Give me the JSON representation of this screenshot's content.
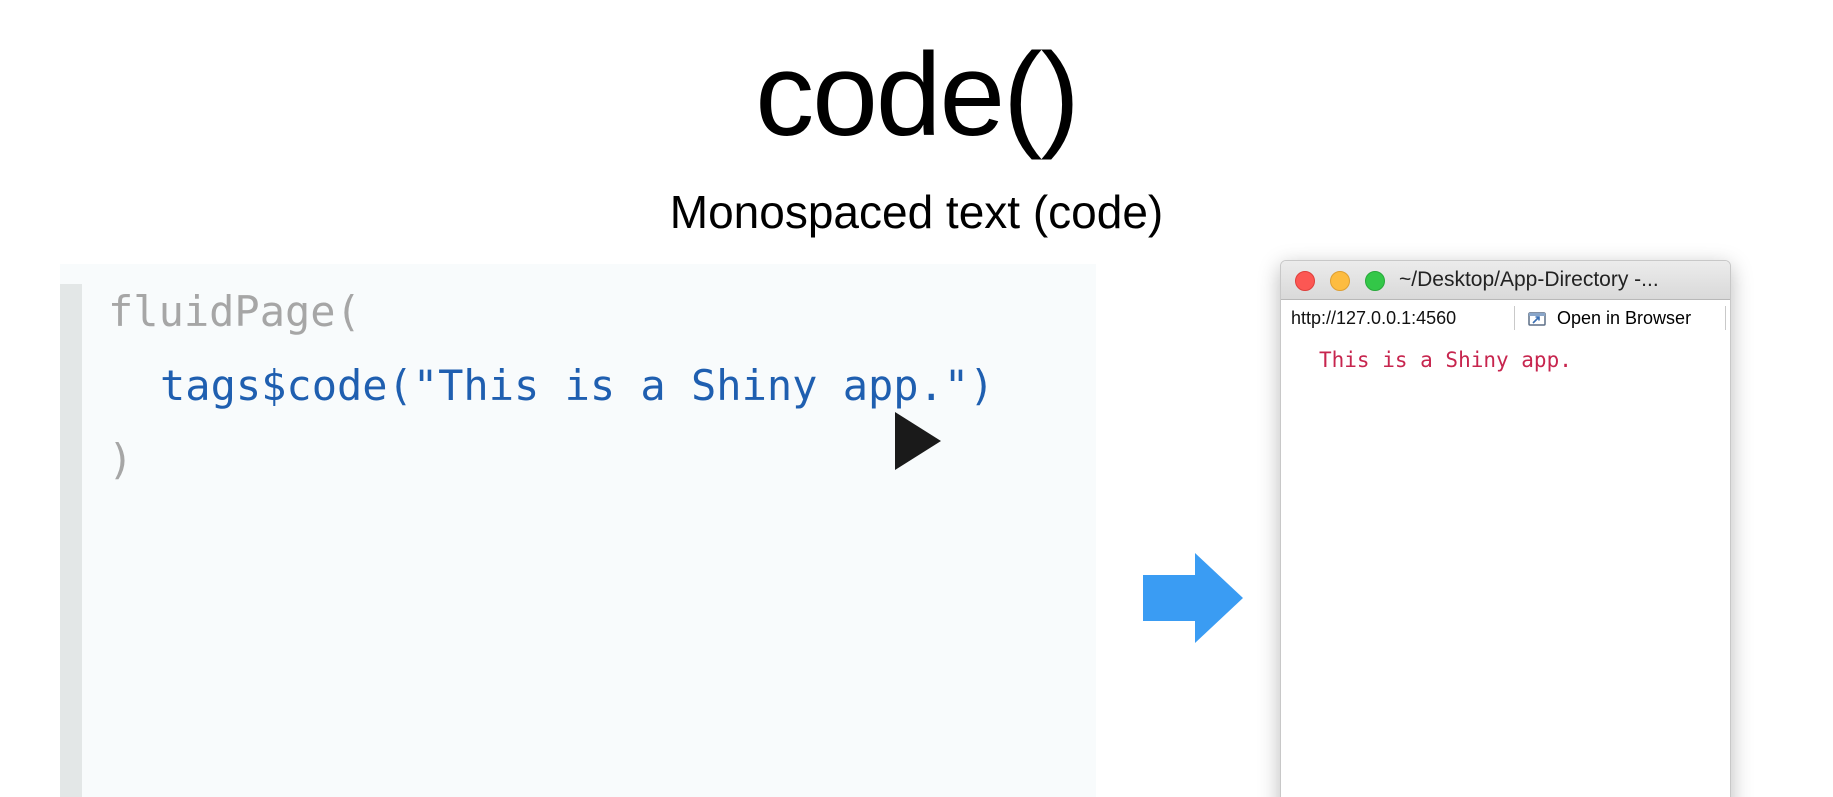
{
  "slide": {
    "title": "code()",
    "subtitle": "Monospaced text (code)"
  },
  "code_example": {
    "line1": "fluidPage(",
    "line2": "tags$code(\"This is a Shiny app.\")",
    "line3": ")",
    "muted_color": "#a6a6a6",
    "accent_color": "#1f5fb0"
  },
  "icons": {
    "play": "play-icon",
    "arrow": "arrow-right-icon",
    "open_in_browser": "open-in-browser-icon"
  },
  "app_window": {
    "title": "~/Desktop/App-Directory -...",
    "url": "http://127.0.0.1:4560",
    "open_in_browser_label": "Open in Browser",
    "output_text": "This is a Shiny app.",
    "output_color": "#c7254e"
  },
  "colors": {
    "arrow": "#3a9cf3",
    "close": "#fc5753",
    "minimize": "#fdbc40",
    "maximize": "#33c748"
  }
}
